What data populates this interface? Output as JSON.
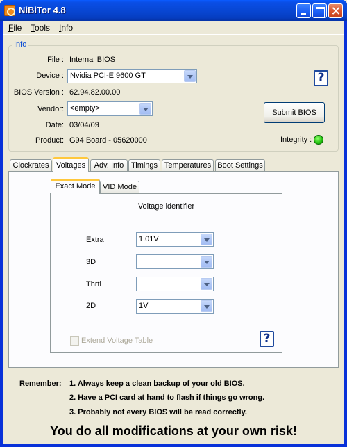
{
  "window": {
    "title": "NiBiTor 4.8"
  },
  "menu": {
    "file": "File",
    "tools": "Tools",
    "info": "Info"
  },
  "info": {
    "legend": "Info",
    "file_label": "File :",
    "file_value": "Internal BIOS",
    "device_label": "Device :",
    "device_value": "Nvidia PCI-E 9600 GT",
    "bios_version_label": "BIOS Version :",
    "bios_version_value": "62.94.82.00.00",
    "vendor_label": "Vendor:",
    "vendor_value": "<empty>",
    "date_label": "Date:",
    "date_value": "03/04/09",
    "product_label": "Product:",
    "product_value": "G94 Board - 05620000",
    "submit_label": "Submit BIOS",
    "integrity_label": "Integrity :",
    "integrity_color": "#21c10e",
    "help_label": "?"
  },
  "tabs": [
    "Clockrates",
    "Voltages",
    "Adv. Info",
    "Timings",
    "Temperatures",
    "Boot Settings"
  ],
  "active_tab": "Voltages",
  "subtabs": [
    "Exact Mode",
    "VID Mode"
  ],
  "active_subtab": "Exact Mode",
  "voltages": {
    "heading": "Voltage identifier",
    "rows": [
      {
        "label": "Extra",
        "value": "1.01V"
      },
      {
        "label": "3D",
        "value": ""
      },
      {
        "label": "Thrtl",
        "value": ""
      },
      {
        "label": "2D",
        "value": "1V"
      }
    ],
    "extend_label": "Extend Voltage Table",
    "help_label": "?"
  },
  "remember": {
    "label": "Remember:",
    "lines": [
      "1. Always keep a clean backup of your old BIOS.",
      "2. Have a PCI card at hand to flash if things go wrong.",
      "3. Probably not every BIOS will be read correctly."
    ]
  },
  "warning": "You do all modifications at your own risk!"
}
